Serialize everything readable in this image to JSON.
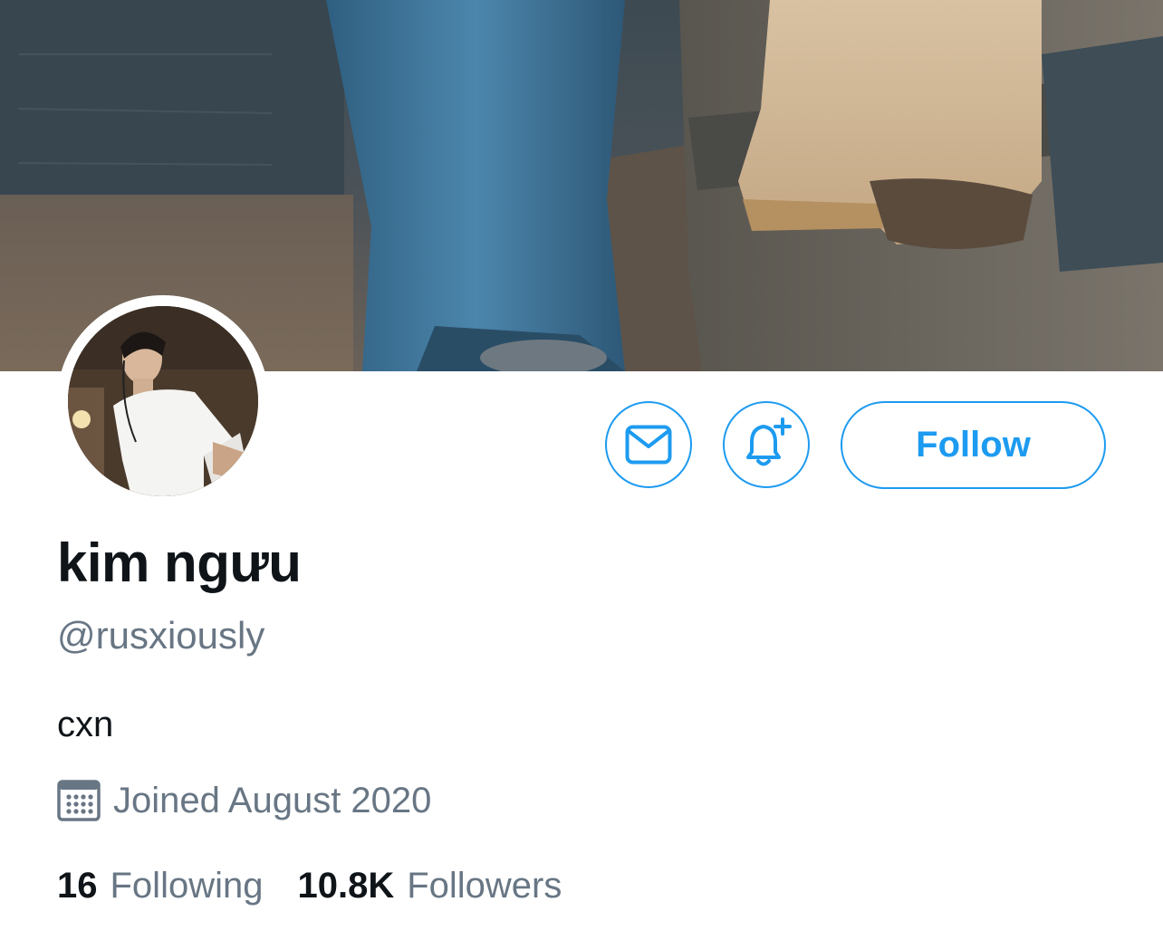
{
  "profile": {
    "display_name": "kim ngưu",
    "handle": "@rusxiously",
    "bio": "cxn",
    "joined": "Joined August 2020",
    "joined_icon": "calendar-icon"
  },
  "stats": {
    "following_count": "16",
    "following_label": "Following",
    "followers_count": "10.8K",
    "followers_label": "Followers"
  },
  "actions": {
    "message_icon": "envelope-icon",
    "notify_icon": "bell-plus-icon",
    "follow_label": "Follow"
  },
  "colors": {
    "accent": "#1d9bf0",
    "text_primary": "#0f1419",
    "text_secondary": "#687684"
  }
}
